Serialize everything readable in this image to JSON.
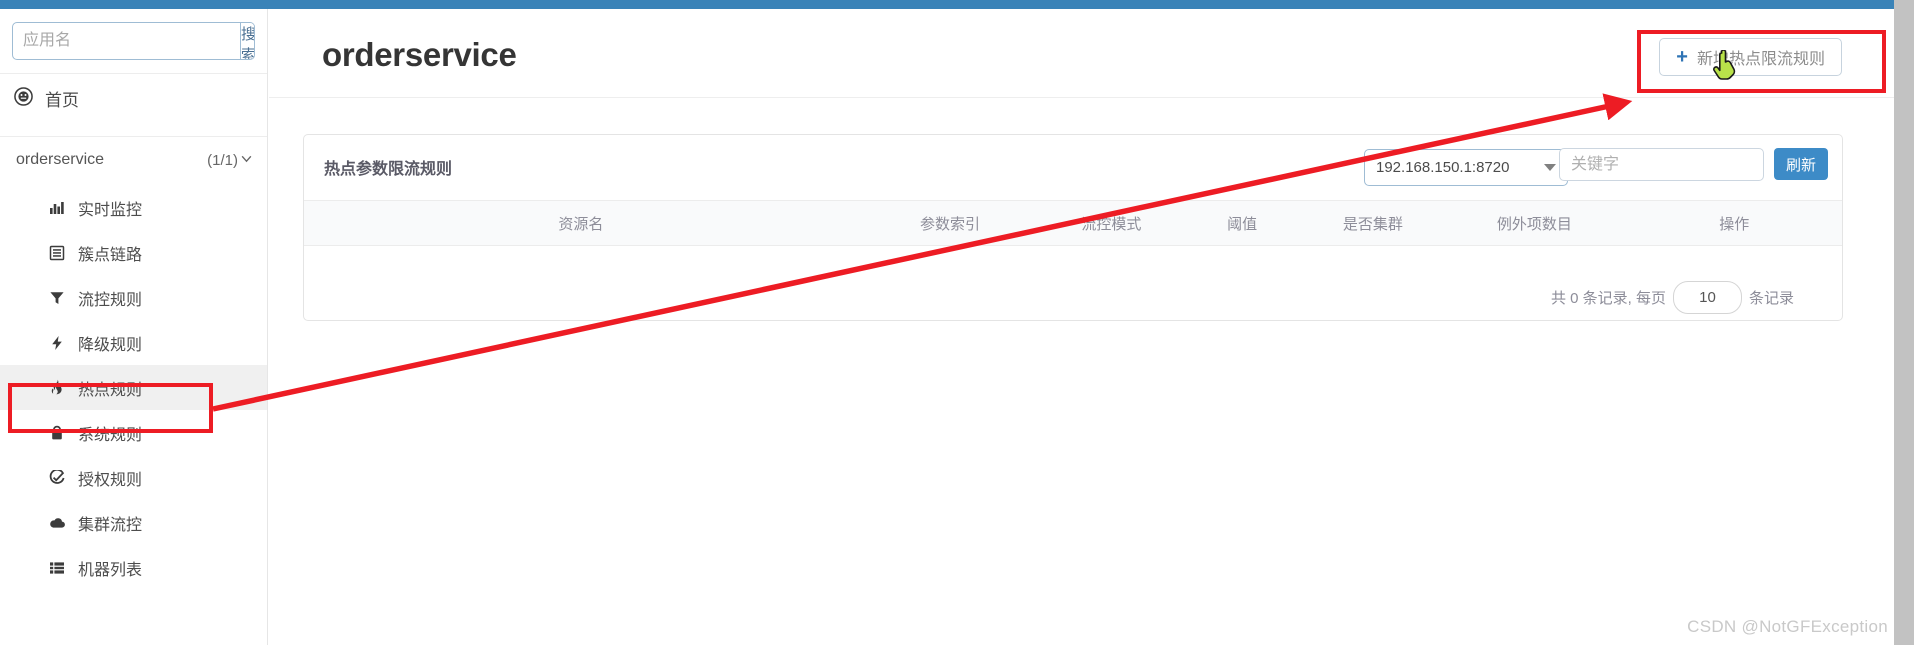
{
  "theme": {
    "topbar_color": "#3a83b8",
    "primary_button_color": "#3d8bc7",
    "accent_plus_color": "#2f74b5",
    "annotation_color": "#ed1c24",
    "active_menu_bg": "#f0f0f0"
  },
  "sidebar": {
    "search": {
      "placeholder": "应用名",
      "value": "",
      "button_label": "搜索"
    },
    "home": {
      "label": "首页",
      "icon": "dashboard-icon"
    },
    "app_group": {
      "name": "orderservice",
      "count": "(1/1)",
      "chevron": "chevron-down-icon"
    },
    "items": [
      {
        "label": "实时监控",
        "icon": "bar-chart-icon",
        "active": false
      },
      {
        "label": "簇点链路",
        "icon": "list-panel-icon",
        "active": false
      },
      {
        "label": "流控规则",
        "icon": "funnel-icon",
        "active": false
      },
      {
        "label": "降级规则",
        "icon": "bolt-icon",
        "active": false
      },
      {
        "label": "热点规则",
        "icon": "fire-icon",
        "active": true
      },
      {
        "label": "系统规则",
        "icon": "lock-icon",
        "active": false
      },
      {
        "label": "授权规则",
        "icon": "check-circle-icon",
        "active": false
      },
      {
        "label": "集群流控",
        "icon": "cloud-icon",
        "active": false
      },
      {
        "label": "机器列表",
        "icon": "server-list-icon",
        "active": false
      }
    ]
  },
  "header": {
    "title": "orderservice",
    "add_button": {
      "label": "新增热点限流规则",
      "icon": "plus-icon"
    }
  },
  "card": {
    "title": "热点参数限流规则",
    "machine_select": {
      "value": "192.168.150.1:8720",
      "icon": "caret-down-icon"
    },
    "keyword_input": {
      "placeholder": "关键字",
      "value": ""
    },
    "refresh_button": "刷新",
    "table": {
      "columns": [
        "资源名",
        "参数索引",
        "流控模式",
        "阈值",
        "是否集群",
        "例外项数目",
        "操作"
      ],
      "rows": []
    },
    "pager": {
      "prefix": "共 0 条记录, 每页",
      "page_size": "10",
      "suffix": "条记录"
    }
  },
  "annotations": {
    "highlight_menu_item": "热点规则",
    "highlight_button": "新增热点限流规则",
    "cursor": "pointer-hand-cursor"
  },
  "watermark": "CSDN @NotGFException"
}
